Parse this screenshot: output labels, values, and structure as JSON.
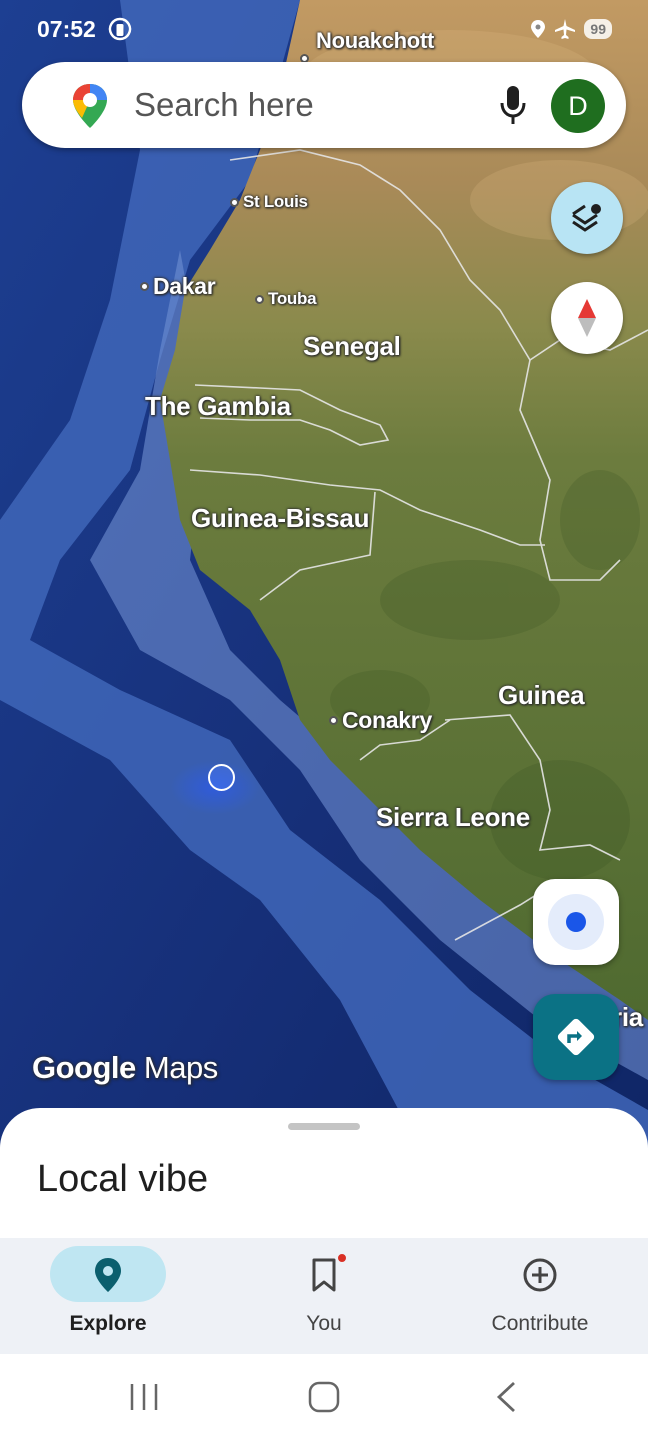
{
  "status_bar": {
    "time": "07:52",
    "battery": "99",
    "icons": [
      "shield-icon",
      "location-icon",
      "airplane-icon",
      "battery-icon"
    ]
  },
  "search": {
    "placeholder": "Search here",
    "avatar_letter": "D",
    "avatar_color": "#1f6e1f"
  },
  "map": {
    "labels": {
      "nouakchott": "Nouakchott",
      "st_louis": "St Louis",
      "dakar": "Dakar",
      "touba": "Touba",
      "senegal": "Senegal",
      "gambia": "The Gambia",
      "guinea_bissau": "Guinea-Bissau",
      "guinea": "Guinea",
      "conakry": "Conakry",
      "sierra_leone": "Sierra Leone",
      "liberia_partial": "ria"
    },
    "logo": {
      "google": "Google",
      "maps": "Maps"
    },
    "colors": {
      "ocean": "#1b3d8f",
      "land": "#6b7a3e",
      "desert": "#b08a58"
    }
  },
  "controls": {
    "layers": "layers-icon",
    "compass": "compass-icon",
    "locate": "my-location-icon",
    "directions": "directions-icon",
    "directions_color": "#0b7285"
  },
  "sheet": {
    "title": "Local vibe"
  },
  "nav": {
    "items": [
      {
        "label": "Explore",
        "icon": "explore-pin-icon",
        "active": true
      },
      {
        "label": "You",
        "icon": "bookmark-icon",
        "active": false
      },
      {
        "label": "Contribute",
        "icon": "add-circle-icon",
        "active": false
      }
    ]
  }
}
